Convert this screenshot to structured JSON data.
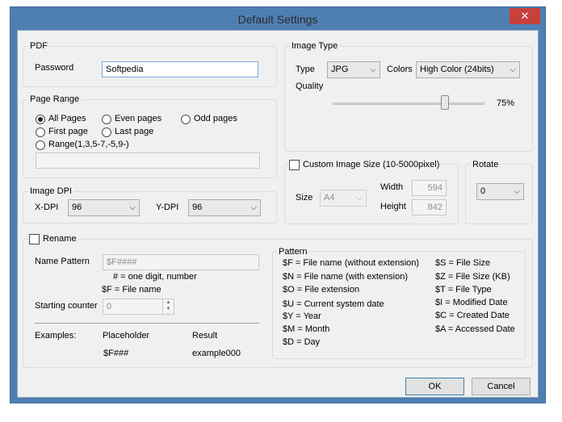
{
  "window": {
    "title": "Default Settings",
    "close_glyph": "✕"
  },
  "pdf": {
    "group_label": "PDF",
    "password_label": "Password",
    "password_value": "Softpedia"
  },
  "page_range": {
    "group_label": "Page Range",
    "all_pages": "All Pages",
    "even_pages": "Even pages",
    "odd_pages": "Odd pages",
    "first_page": "First page",
    "last_page": "Last page",
    "range": "Range(1,3,5-7,-5,9-)",
    "range_value": "",
    "selected": "all_pages"
  },
  "image_dpi": {
    "group_label": "Image DPI",
    "x_label": "X-DPI",
    "x_value": "96",
    "y_label": "Y-DPI",
    "y_value": "96"
  },
  "image_type": {
    "group_label": "Image Type",
    "type_label": "Type",
    "type_value": "JPG",
    "colors_label": "Colors",
    "colors_value": "High Color (24bits)",
    "quality_label": "Quality",
    "quality_value": "75%",
    "quality_level": 0.75
  },
  "custom_size": {
    "label": "Custom Image Size (10-5000pixel)",
    "checked": false,
    "size_label": "Size",
    "size_value": "A4",
    "width_label": "Width",
    "width_value": "594",
    "height_label": "Height",
    "height_value": "842"
  },
  "rotate": {
    "group_label": "Rotate",
    "value": "0"
  },
  "rename": {
    "label": "Rename",
    "checked": false,
    "name_pattern_label": "Name Pattern",
    "name_pattern_value": "$F####",
    "hint_hash": "# = one digit, number",
    "hint_f": "$F = File name",
    "starting_counter_label": "Starting counter",
    "starting_counter_value": "0",
    "examples_label": "Examples:",
    "placeholder_header": "Placeholder",
    "result_header": "Result",
    "placeholder_value": "$F###",
    "result_value": "example000"
  },
  "pattern": {
    "group_label": "Pattern",
    "left": [
      "$F = File name (without extension)",
      "$N = File name (with extension)",
      "$O = File extension",
      "$U = Current system date",
      "$Y = Year",
      "$M = Month",
      "$D = Day"
    ],
    "right": [
      "$S = File Size",
      "$Z = File Size (KB)",
      "$T = File Type",
      "$I = Modified Date",
      "$C = Created Date",
      "$A = Accessed Date"
    ]
  },
  "buttons": {
    "ok": "OK",
    "cancel": "Cancel"
  },
  "icons": {
    "dropdown": "chevron-down-icon",
    "spin_up": "spin-up-icon",
    "spin_down": "spin-down-icon"
  },
  "colors": {
    "title_bar": "#4f7fb2",
    "close_button": "#c7403a",
    "dialog_bg": "#f0f0f0",
    "focus_border": "#7aa7d9"
  }
}
